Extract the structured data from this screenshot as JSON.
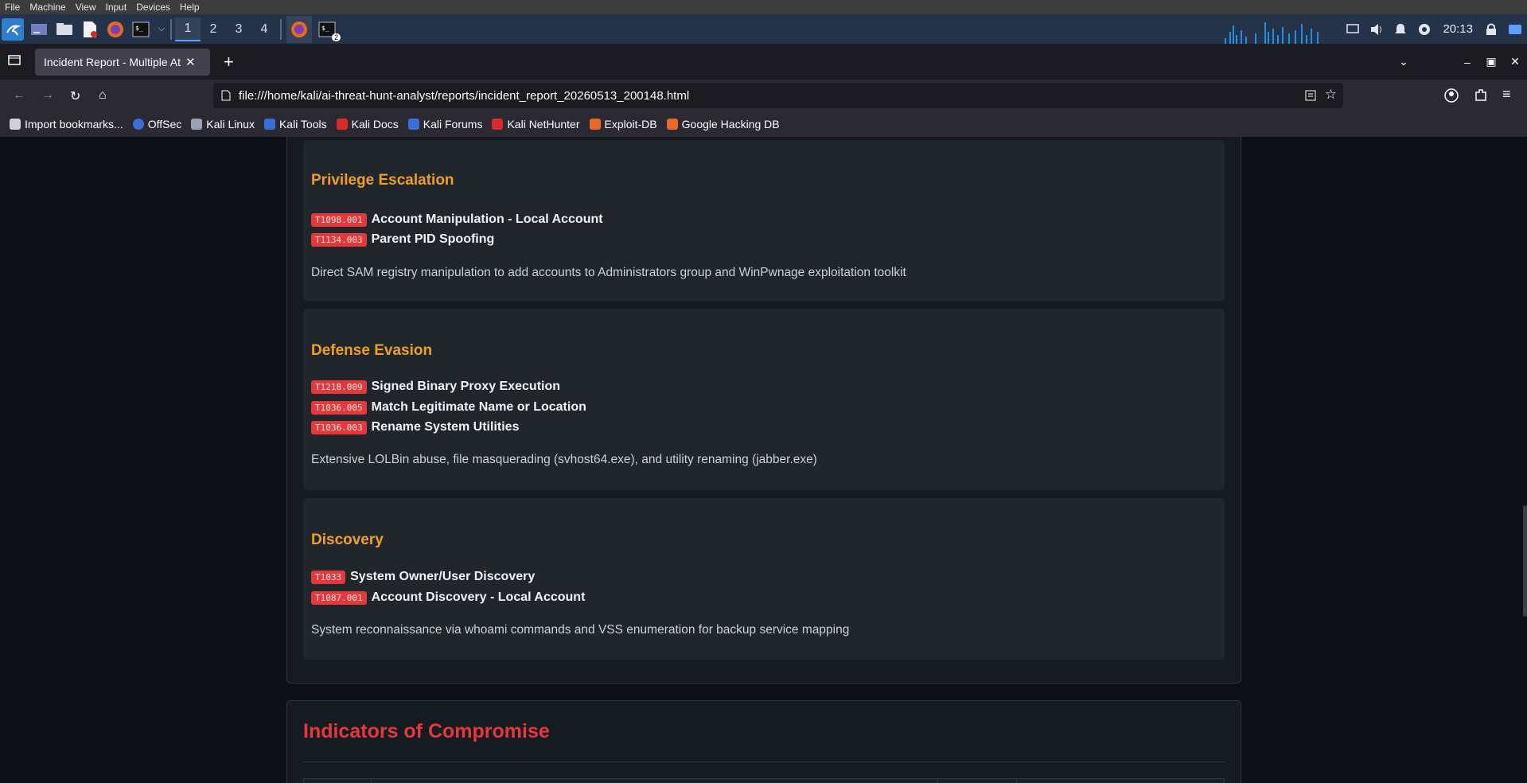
{
  "vm_menu": [
    "File",
    "Machine",
    "View",
    "Input",
    "Devices",
    "Help"
  ],
  "panel": {
    "workspaces": [
      "1",
      "2",
      "3",
      "4"
    ],
    "active_workspace": "1",
    "terminal_badge": "2",
    "clock": "20:13"
  },
  "browser": {
    "tab_title": "Incident Report - Multiple Att",
    "url": "file:///home/kali/ai-threat-hunt-analyst/reports/incident_report_20260513_200148.html",
    "bookmarks": [
      {
        "label": "Import bookmarks...",
        "color": "#cfcfd8"
      },
      {
        "label": "OffSec",
        "color": "#3b6fd8"
      },
      {
        "label": "Kali Linux",
        "color": "#9aa3b5"
      },
      {
        "label": "Kali Tools",
        "color": "#3b6fd8"
      },
      {
        "label": "Kali Docs",
        "color": "#d82b2b"
      },
      {
        "label": "Kali Forums",
        "color": "#3b6fd8"
      },
      {
        "label": "Kali NetHunter",
        "color": "#d82b2b"
      },
      {
        "label": "Exploit-DB",
        "color": "#e8692a"
      },
      {
        "label": "Google Hacking DB",
        "color": "#e8692a"
      }
    ]
  },
  "report": {
    "tactics": [
      {
        "name": "Privilege Escalation",
        "techniques": [
          {
            "id": "T1098.001",
            "name": "Account Manipulation - Local Account"
          },
          {
            "id": "T1134.003",
            "name": "Parent PID Spoofing"
          }
        ],
        "description": "Direct SAM registry manipulation to add accounts to Administrators group and WinPwnage exploitation toolkit"
      },
      {
        "name": "Defense Evasion",
        "techniques": [
          {
            "id": "T1218.009",
            "name": "Signed Binary Proxy Execution"
          },
          {
            "id": "T1036.005",
            "name": "Match Legitimate Name or Location"
          },
          {
            "id": "T1036.003",
            "name": "Rename System Utilities"
          }
        ],
        "description": "Extensive LOLBin abuse, file masquerading (svhost64.exe), and utility renaming (jabber.exe)"
      },
      {
        "name": "Discovery",
        "techniques": [
          {
            "id": "T1033",
            "name": "System Owner/User Discovery"
          },
          {
            "id": "T1087.001",
            "name": "Account Discovery - Local Account"
          }
        ],
        "description": "System reconnaissance via whoami commands and VSS enumeration for backup service mapping"
      }
    ],
    "ioc_title": "Indicators of Compromise"
  },
  "colors": {
    "tactic_heading": "#f0a020",
    "technique_badge": "#e5383b",
    "ioc_heading": "#e5383b"
  }
}
